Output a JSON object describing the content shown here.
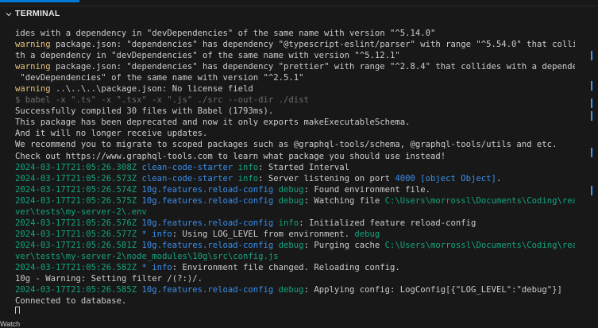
{
  "panel": {
    "title": "TERMINAL",
    "accent_color": "#0078d4",
    "footer_label": "Watch"
  },
  "lines": [
    [
      {
        "t": "ides with a dependency in \"devDependencies\" of the same name with version \"^5.14.0\"",
        "c": "plain"
      }
    ],
    [
      {
        "t": "warning",
        "c": "warn"
      },
      {
        "t": " package.json: \"dependencies\" has dependency \"@typescript-eslint/parser\" with range \"^5.54.0\" that collides wi",
        "c": "plain"
      }
    ],
    [
      {
        "t": "th a dependency in \"devDependencies\" of the same name with version \"^5.12.1\"",
        "c": "plain"
      }
    ],
    [
      {
        "t": "warning",
        "c": "warn"
      },
      {
        "t": " package.json: \"dependencies\" has dependency \"prettier\" with range \"^2.8.4\" that collides with a dependency in",
        "c": "plain"
      }
    ],
    [
      {
        "t": " \"devDependencies\" of the same name with version \"^2.5.1\"",
        "c": "plain"
      }
    ],
    [
      {
        "t": "warning",
        "c": "warn"
      },
      {
        "t": " ..\\..\\..\\package.json: No license field",
        "c": "plain"
      }
    ],
    [
      {
        "t": "$ babel -x \".ts\" -x \".tsx\" -x \".js\" ./src --out-dir ./dist",
        "c": "grey"
      }
    ],
    [
      {
        "t": "Successfully compiled 30 files with Babel (1793ms).",
        "c": "plain"
      }
    ],
    [
      {
        "t": "This package has been deprecated and now it only exports makeExecutableSchema.",
        "c": "plain"
      }
    ],
    [
      {
        "t": "And it will no longer receive updates.",
        "c": "plain"
      }
    ],
    [
      {
        "t": "We recommend you to migrate to scoped packages such as @graphql-tools/schema, @graphql-tools/utils and etc.",
        "c": "plain"
      }
    ],
    [
      {
        "t": "Check out https://www.graphql-tools.com to learn what package you should use instead!",
        "c": "plain"
      }
    ],
    [
      {
        "t": "2024-03-17T21:05:26.308Z",
        "c": "ts"
      },
      {
        "t": " clean-code-starter",
        "c": "ns"
      },
      {
        "t": " info",
        "c": "lvl"
      },
      {
        "t": ": Started Interval",
        "c": "plain"
      }
    ],
    [
      {
        "t": "2024-03-17T21:05:26.573Z",
        "c": "ts"
      },
      {
        "t": " clean-code-starter",
        "c": "ns"
      },
      {
        "t": " info",
        "c": "lvl"
      },
      {
        "t": ": Server listening on port ",
        "c": "plain"
      },
      {
        "t": "4000",
        "c": "num"
      },
      {
        "t": " [object Object]",
        "c": "ns"
      },
      {
        "t": ".",
        "c": "plain"
      }
    ],
    [
      {
        "t": "2024-03-17T21:05:26.574Z",
        "c": "ts"
      },
      {
        "t": " 10g.features.reload-config",
        "c": "ns"
      },
      {
        "t": " debug",
        "c": "lvl"
      },
      {
        "t": ": Found environment file.",
        "c": "plain"
      }
    ],
    [
      {
        "t": "2024-03-17T21:05:26.575Z",
        "c": "ts"
      },
      {
        "t": " 10g.features.reload-config",
        "c": "ns"
      },
      {
        "t": " debug",
        "c": "lvl"
      },
      {
        "t": ": Watching file ",
        "c": "plain"
      },
      {
        "t": "C:\\Users\\morrossl\\Documents\\Coding\\react-ser",
        "c": "path"
      }
    ],
    [
      {
        "t": "ver\\tests\\my-server-2\\.env",
        "c": "path"
      }
    ],
    [
      {
        "t": "2024-03-17T21:05:26.576Z",
        "c": "ts"
      },
      {
        "t": " 10g.features.reload-config",
        "c": "ns"
      },
      {
        "t": " info",
        "c": "lvl"
      },
      {
        "t": ": Initialized feature reload-config",
        "c": "plain"
      }
    ],
    [
      {
        "t": "2024-03-17T21:05:26.577Z",
        "c": "ts"
      },
      {
        "t": " * info",
        "c": "ns"
      },
      {
        "t": ": Using LOG_LEVEL from environment. ",
        "c": "plain"
      },
      {
        "t": "debug",
        "c": "lvl"
      }
    ],
    [
      {
        "t": "2024-03-17T21:05:26.581Z",
        "c": "ts"
      },
      {
        "t": " 10g.features.reload-config",
        "c": "ns"
      },
      {
        "t": " debug",
        "c": "lvl"
      },
      {
        "t": ": Purging cache ",
        "c": "plain"
      },
      {
        "t": "C:\\Users\\morrossl\\Documents\\Coding\\react-ser",
        "c": "path"
      }
    ],
    [
      {
        "t": "ver\\tests\\my-server-2\\node_modules\\10g\\src\\config.js",
        "c": "path"
      }
    ],
    [
      {
        "t": "2024-03-17T21:05:26.582Z",
        "c": "ts"
      },
      {
        "t": " * info",
        "c": "ns"
      },
      {
        "t": ": Environment file changed. Reloading config.",
        "c": "plain"
      }
    ],
    [
      {
        "t": "10g - Warning: Setting filter /(?:)/.",
        "c": "plain"
      }
    ],
    [
      {
        "t": "2024-03-17T21:05:26.585Z",
        "c": "ts"
      },
      {
        "t": " 10g.features.reload-config",
        "c": "ns"
      },
      {
        "t": " debug",
        "c": "lvl"
      },
      {
        "t": ": Applying config: LogConfig[{\"LOG_LEVEL\":\"debug\"}]",
        "c": "plain"
      }
    ],
    [
      {
        "t": "Connected to database.",
        "c": "plain"
      }
    ]
  ],
  "scroll_marks": [
    {
      "color": "#3794ff"
    },
    {
      "color": "#3794ff"
    },
    {
      "color": "#3794ff"
    },
    {
      "color": "#3794ff"
    },
    {
      "color": "#3794ff"
    },
    {
      "color": "#3794ff"
    }
  ]
}
